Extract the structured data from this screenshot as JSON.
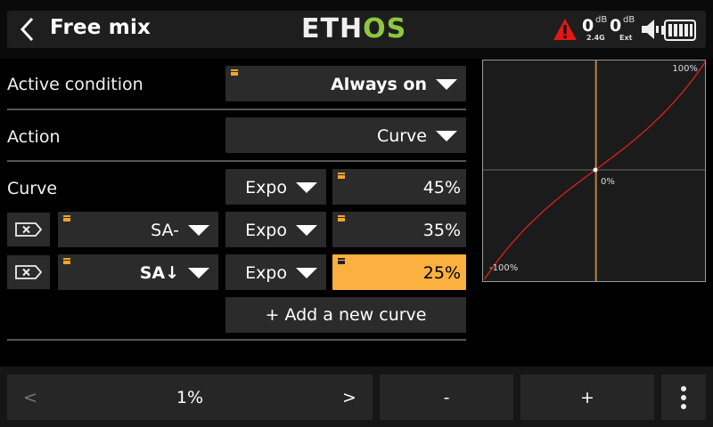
{
  "header": {
    "title": "Free mix",
    "logo": {
      "part1": "ETH",
      "part2": "OS"
    },
    "rssi_internal": {
      "value": "0",
      "unit": "dB",
      "label": "2.4G"
    },
    "rssi_external": {
      "value": "0",
      "unit": "dB",
      "label": "Ext"
    }
  },
  "rows": {
    "active_condition": {
      "label": "Active condition",
      "value": "Always on"
    },
    "action": {
      "label": "Action",
      "value": "Curve"
    },
    "curve": {
      "label": "Curve",
      "type": "Expo",
      "value": "45%"
    },
    "curve_rows": [
      {
        "switch": "SA-",
        "type": "Expo",
        "value": "35%"
      },
      {
        "switch": "SA↓",
        "type": "Expo",
        "value": "25%"
      }
    ],
    "add_curve": "+ Add a new curve"
  },
  "graph": {
    "top_label": "100%",
    "center_label": "0%",
    "bottom_label": "-100%",
    "expo_percent": 25
  },
  "footer": {
    "prev": "<",
    "value": "1%",
    "next": ">",
    "minus": "-",
    "plus": "+"
  },
  "colors": {
    "accent": "#fcb040",
    "logo_green": "#8ec63f",
    "curve": "#e02020",
    "warning": "#e01818"
  }
}
